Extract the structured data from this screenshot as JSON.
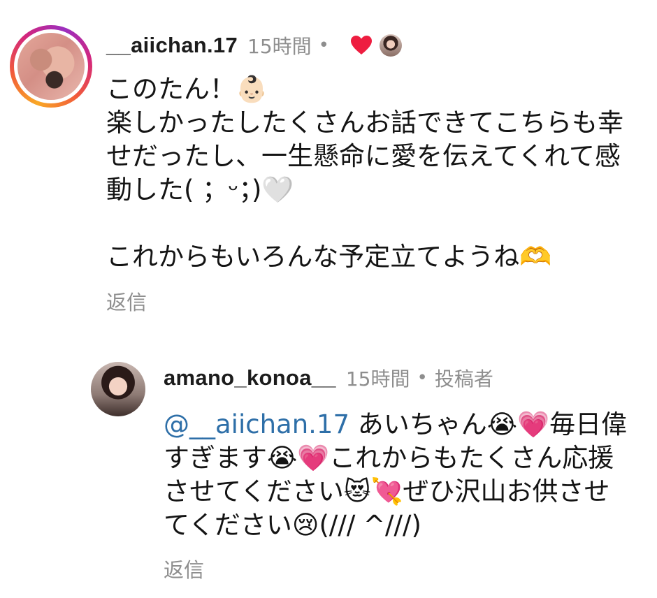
{
  "comment1": {
    "username": "__aiichan.17",
    "time": "15時間",
    "dot": "•",
    "lines": [
      "このたん！👶🏻",
      "楽しかったしたくさんお話できてこちらも幸",
      "せだったし、一生懸命に愛を伝えてくれて感",
      "動した( ；ᵕ；)🤍",
      "",
      "これからもいろんな予定立てようね🫶"
    ],
    "reply_label": "返信",
    "liked_color": "#ee1d40"
  },
  "comment2": {
    "username": "amano_konoa__",
    "time": "15時間",
    "dot": "•",
    "author_badge": "投稿者",
    "mention": "@__aiichan.17",
    "lines": [
      " あいちゃん😭💗毎日偉",
      "すぎます😭💗これからもたくさん応援",
      "させてください😻💘ぜひ沢山お供させ",
      "てください😢(/// ^///)"
    ],
    "reply_label": "返信",
    "mention_color": "#2e6fa8"
  }
}
